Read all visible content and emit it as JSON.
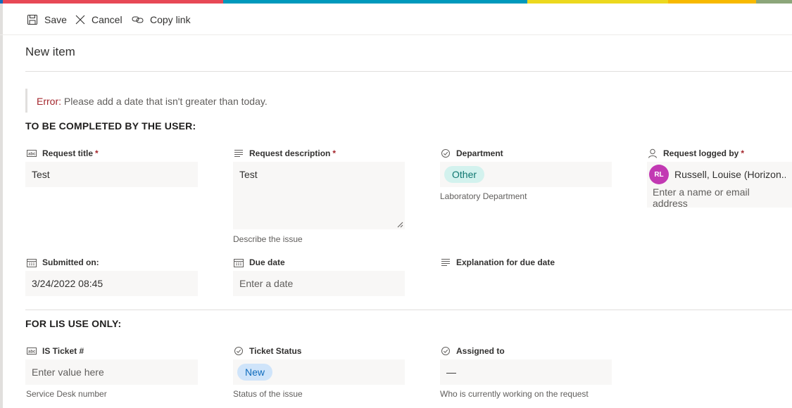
{
  "colors": {
    "accent": "#0f6cbd",
    "error": "#a4262c",
    "field_bg": "#f8f7f6",
    "avatar": "#c239b3"
  },
  "brand_bar": [
    "#0f6cbd",
    "#e74856",
    "#0099bc",
    "#ecd81e",
    "#f7b900",
    "#8ca67a"
  ],
  "toolbar": {
    "save_label": "Save",
    "cancel_label": "Cancel",
    "copy_link_label": "Copy link"
  },
  "form": {
    "title": "New item",
    "error": {
      "label": "Error:",
      "message": " Please add a date that isn't greater than today."
    },
    "section_user": "TO BE COMPLETED BY THE USER:",
    "section_lis": "FOR LIS USE ONLY:",
    "required_mark": "*",
    "fields": {
      "request_title": {
        "label": "Request title",
        "value": "Test",
        "icon": "text-field-icon"
      },
      "request_description": {
        "label": "Request description",
        "value": "Test",
        "hint": "Describe the issue",
        "icon": "multiline-text-icon"
      },
      "department": {
        "label": "Department",
        "value": "Other",
        "hint": "Laboratory Department",
        "icon": "choice-icon"
      },
      "request_logged_by": {
        "label": "Request logged by",
        "avatar_initials": "RL",
        "person": "Russell, Louise (Horizon...",
        "placeholder": "Enter a name or email address",
        "icon": "person-icon"
      },
      "submitted_on": {
        "label": "Submitted on:",
        "value": "3/24/2022 08:45",
        "icon": "calendar-icon"
      },
      "due_date": {
        "label": "Due date",
        "placeholder": "Enter a date",
        "icon": "calendar-icon"
      },
      "explanation_due_date": {
        "label": "Explanation for due date",
        "icon": "multiline-text-icon"
      },
      "is_ticket": {
        "label": "IS Ticket #",
        "placeholder": "Enter value here",
        "hint": "Service Desk number",
        "icon": "text-field-icon"
      },
      "ticket_status": {
        "label": "Ticket Status",
        "value": "New",
        "hint": "Status of the issue",
        "icon": "choice-icon"
      },
      "assigned_to": {
        "label": "Assigned to",
        "value": "—",
        "hint": "Who is currently working on the request",
        "icon": "choice-icon"
      }
    }
  }
}
